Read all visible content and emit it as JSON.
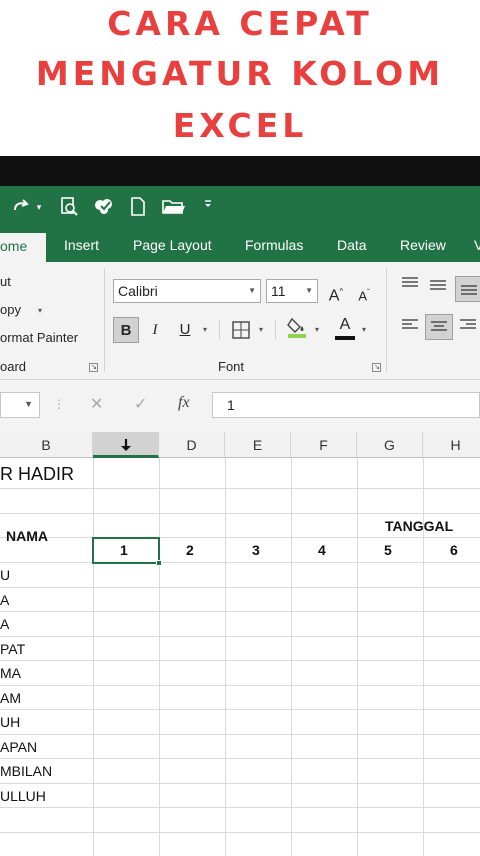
{
  "title": {
    "line1": "CARA CEPAT",
    "line2": "MENGATUR KOLOM",
    "line3": "EXCEL",
    "color": "#e8403f"
  },
  "quick_access": {
    "icons": [
      "redo-icon",
      "print-preview-icon",
      "spell-check-icon",
      "new-file-icon",
      "open-folder-icon",
      "customize-qat-icon"
    ]
  },
  "tabs": {
    "home": "ome",
    "insert": "Insert",
    "page_layout": "Page Layout",
    "formulas": "Formulas",
    "data": "Data",
    "review": "Review"
  },
  "clipboard": {
    "cut": "ut",
    "copy": "opy",
    "format_painter": "ormat Painter",
    "group_label": "oard"
  },
  "font_group": {
    "font_name": "Calibri",
    "font_size": "11",
    "bold": "B",
    "italic": "I",
    "underline": "U",
    "font_color": "A",
    "group_label": "Font"
  },
  "formula_bar": {
    "fx_label": "fx",
    "value": "1"
  },
  "sheet": {
    "columns": [
      "B",
      "C",
      "D",
      "E",
      "F",
      "G",
      "H"
    ],
    "selected_column": "C",
    "title_cell": "R HADIR",
    "nama_header": "NAMA",
    "tanggal_header": "TANGGAL",
    "day_numbers": [
      "1",
      "2",
      "3",
      "4",
      "5",
      "6"
    ],
    "names": [
      "U",
      "A",
      "A",
      "PAT",
      "MA",
      "AM",
      "UH",
      "APAN",
      "MBILAN",
      "ULLUH"
    ]
  },
  "colors": {
    "excel_green": "#217346",
    "ribbon_bg": "#f3f3f3"
  }
}
